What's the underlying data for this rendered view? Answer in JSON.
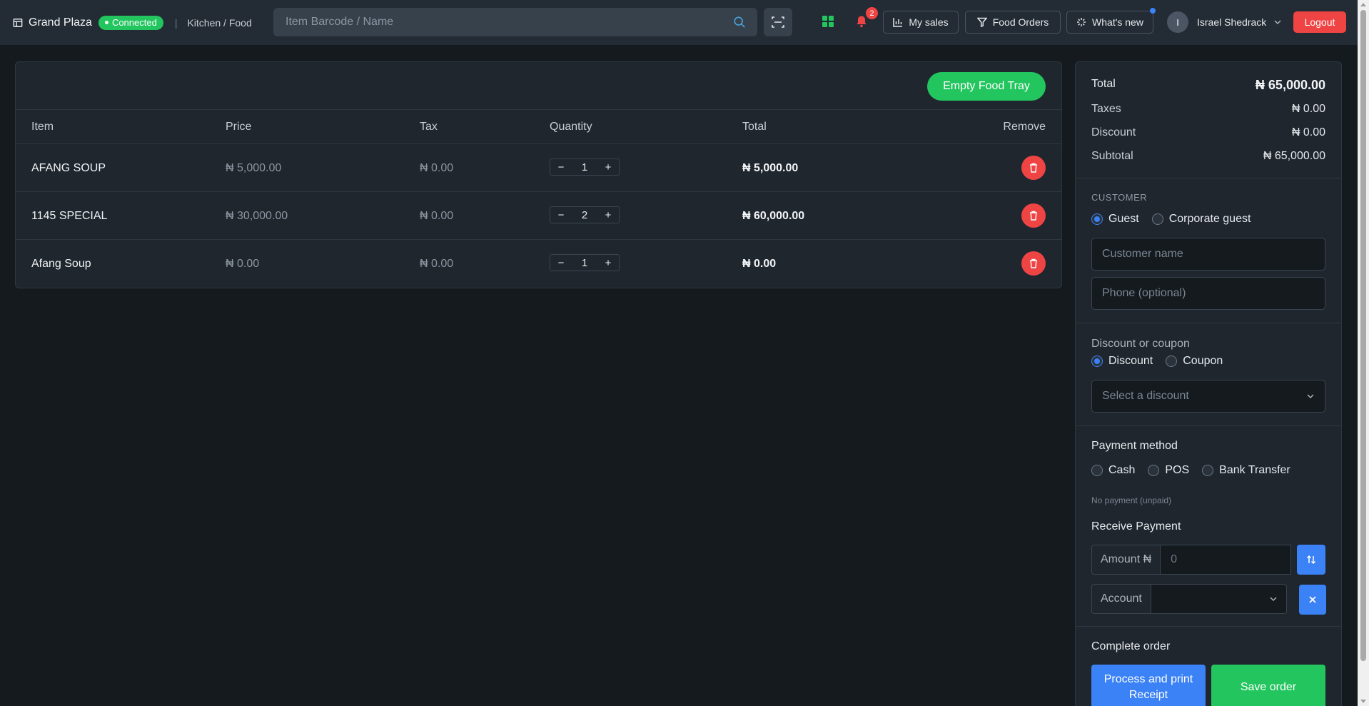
{
  "header": {
    "brand": "Grand Plaza",
    "status": "Connected",
    "separator": "|",
    "breadcrumb": "Kitchen / Food",
    "search_placeholder": "Item Barcode / Name",
    "notifications_count": "2",
    "my_sales": "My sales",
    "food_orders": "Food Orders",
    "whats_new": "What's new",
    "user_initial": "I",
    "user_name": "Israel Shedrack",
    "logout": "Logout"
  },
  "tray": {
    "empty_button": "Empty Food Tray",
    "columns": [
      "Item",
      "Price",
      "Tax",
      "Quantity",
      "Total",
      "Remove"
    ],
    "rows": [
      {
        "item": "AFANG SOUP",
        "price": "₦ 5,000.00",
        "tax": "₦ 0.00",
        "qty": "1",
        "total": "₦ 5,000.00"
      },
      {
        "item": "1145 SPECIAL",
        "price": "₦ 30,000.00",
        "tax": "₦ 0.00",
        "qty": "2",
        "total": "₦ 60,000.00"
      },
      {
        "item": "Afang Soup",
        "price": "₦ 0.00",
        "tax": "₦ 0.00",
        "qty": "1",
        "total": "₦ 0.00"
      }
    ],
    "minus": "−",
    "plus": "+"
  },
  "summary": {
    "total_label": "Total",
    "total_value": "₦ 65,000.00",
    "taxes_label": "Taxes",
    "taxes_value": "₦ 0.00",
    "discount_label": "Discount",
    "discount_value": "₦ 0.00",
    "subtotal_label": "Subtotal",
    "subtotal_value": "₦ 65,000.00"
  },
  "customer": {
    "label": "CUSTOMER",
    "guest": "Guest",
    "corporate": "Corporate guest",
    "name_placeholder": "Customer name",
    "phone_placeholder": "Phone (optional)"
  },
  "discount": {
    "title": "Discount or coupon",
    "discount": "Discount",
    "coupon": "Coupon",
    "select_placeholder": "Select a discount"
  },
  "payment": {
    "title": "Payment method",
    "cash": "Cash",
    "pos": "POS",
    "bank": "Bank Transfer",
    "status": "No payment (unpaid)",
    "receive_title": "Receive Payment",
    "amount_label": "Amount ₦",
    "amount_placeholder": "0",
    "account_label": "Account"
  },
  "complete": {
    "title": "Complete order",
    "print_button": "Process and print Receipt",
    "save_button": "Save order"
  },
  "colors": {
    "accent_green": "#22c55e",
    "accent_blue": "#3b82f6",
    "danger": "#ef4444",
    "background": "#151a1f",
    "panel": "#1f262e"
  }
}
